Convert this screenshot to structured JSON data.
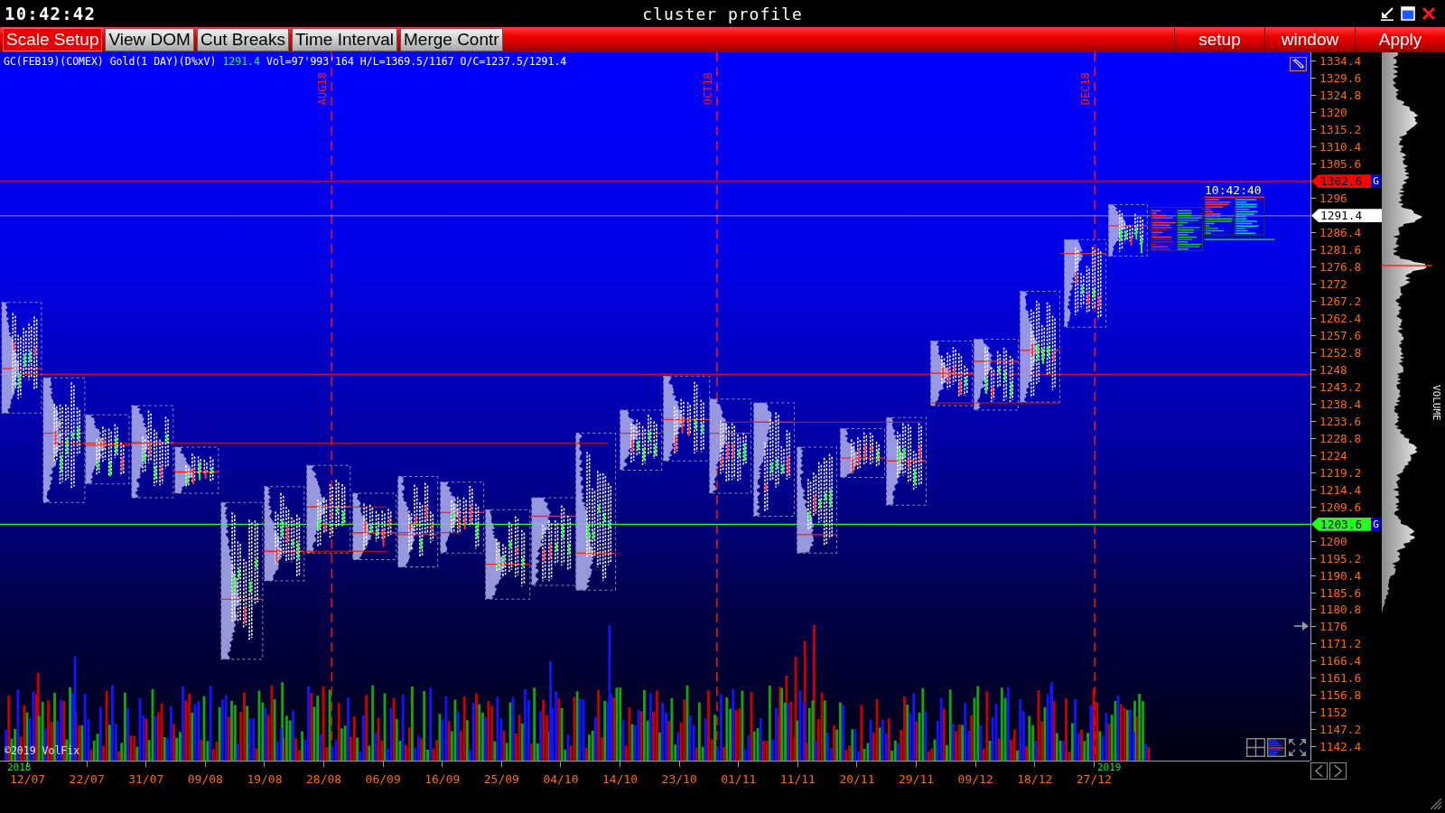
{
  "title_bar": {
    "clock": "10:42:42",
    "title": "cluster profile"
  },
  "toolbar": {
    "tabs": [
      {
        "label": "Scale Setup",
        "selected": true
      },
      {
        "label": "View DOM",
        "selected": false
      },
      {
        "label": "Cut Breaks",
        "selected": false
      },
      {
        "label": "Time Interval",
        "selected": false
      },
      {
        "label": "Merge Contr",
        "selected": false
      }
    ],
    "buttons": [
      "setup",
      "window",
      "Apply"
    ]
  },
  "chart": {
    "info": {
      "symbol": "GC(FEB19)(COMEX) Gold(1 DAY)(D%xV)",
      "last": "1291.4",
      "stats": "Vol=97'993'164 H/L=1369.5/1167 O/C=1237.5/1291.4"
    },
    "months": [
      "AUG18",
      "OCT18",
      "DEC18"
    ],
    "last_update": "10:42:40",
    "copyright": "©2019 VolFix"
  },
  "price_axis": {
    "items": [
      {
        "kind": "tick",
        "label": "1334.4"
      },
      {
        "kind": "tick",
        "label": "1329.6"
      },
      {
        "kind": "tick",
        "label": "1324.8"
      },
      {
        "kind": "tick",
        "label": "1320"
      },
      {
        "kind": "tick",
        "label": "1315.2"
      },
      {
        "kind": "tick",
        "label": "1310.4"
      },
      {
        "kind": "tick",
        "label": "1305.6"
      },
      {
        "kind": "marker",
        "label": "1302.6",
        "color": "#ff0000",
        "flag": "G"
      },
      {
        "kind": "tick",
        "label": "1296"
      },
      {
        "kind": "marker",
        "label": "1291.4",
        "color": "#ffffff"
      },
      {
        "kind": "tick",
        "label": "1286.4"
      },
      {
        "kind": "tick",
        "label": "1281.6"
      },
      {
        "kind": "tick",
        "label": "1276.8"
      },
      {
        "kind": "tick",
        "label": "1272"
      },
      {
        "kind": "tick",
        "label": "1267.2"
      },
      {
        "kind": "tick",
        "label": "1262.4"
      },
      {
        "kind": "tick",
        "label": "1257.6"
      },
      {
        "kind": "tick",
        "label": "1252.8"
      },
      {
        "kind": "tick",
        "label": "1248"
      },
      {
        "kind": "tick",
        "label": "1243.2"
      },
      {
        "kind": "tick",
        "label": "1238.4"
      },
      {
        "kind": "tick",
        "label": "1233.6"
      },
      {
        "kind": "tick",
        "label": "1228.8"
      },
      {
        "kind": "tick",
        "label": "1224"
      },
      {
        "kind": "tick",
        "label": "1219.2"
      },
      {
        "kind": "tick",
        "label": "1214.4"
      },
      {
        "kind": "tick",
        "label": "1209.6"
      },
      {
        "kind": "marker",
        "label": "1203.6",
        "color": "#20ff20",
        "flag": "G"
      },
      {
        "kind": "tick",
        "label": "1200"
      },
      {
        "kind": "tick",
        "label": "1195.2"
      },
      {
        "kind": "tick",
        "label": "1190.4"
      },
      {
        "kind": "tick",
        "label": "1185.6"
      },
      {
        "kind": "tick",
        "label": "1180.8"
      },
      {
        "kind": "tick",
        "label": "1176"
      },
      {
        "kind": "tick",
        "label": "1171.2"
      },
      {
        "kind": "tick",
        "label": "1166.4"
      },
      {
        "kind": "tick",
        "label": "1161.6"
      },
      {
        "kind": "tick",
        "label": "1156.8"
      },
      {
        "kind": "tick",
        "label": "1152"
      },
      {
        "kind": "tick",
        "label": "1147.2"
      },
      {
        "kind": "tick",
        "label": "1142.4"
      }
    ]
  },
  "volume_profile": {
    "label": "VOLUME"
  },
  "date_axis": {
    "years": [
      "2018",
      "2019"
    ],
    "labels": [
      "12/07",
      "22/07",
      "31/07",
      "09/08",
      "19/08",
      "28/08",
      "06/09",
      "16/09",
      "25/09",
      "04/10",
      "14/10",
      "23/10",
      "01/11",
      "11/11",
      "20/11",
      "29/11",
      "09/12",
      "18/12",
      "27/12"
    ]
  }
}
